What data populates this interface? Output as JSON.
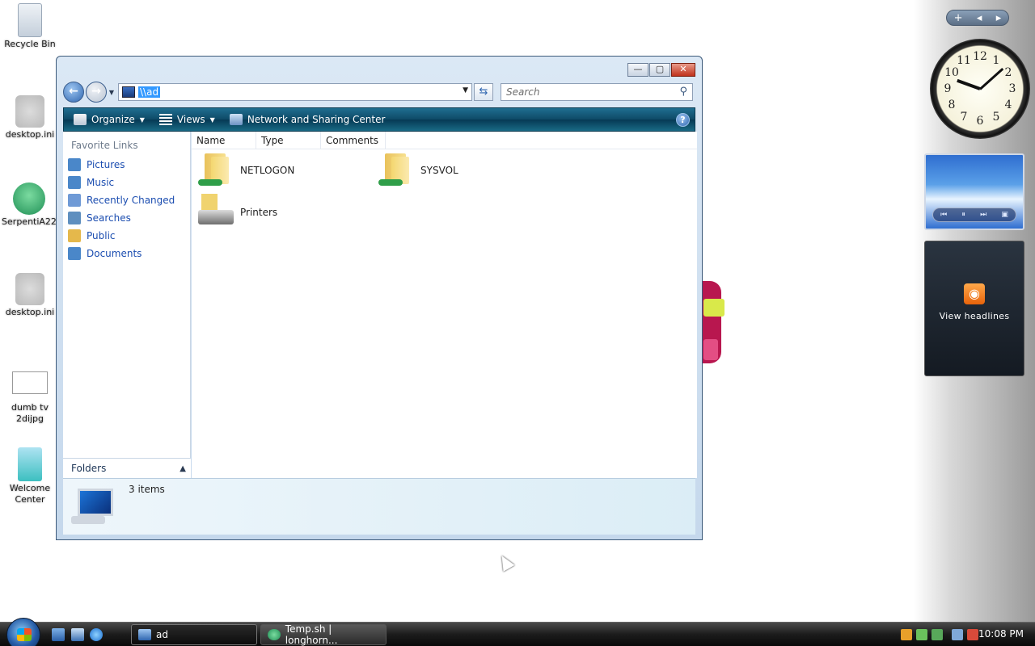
{
  "desktop": {
    "icons": [
      {
        "label": "Recycle Bin"
      },
      {
        "label": "desktop.ini"
      },
      {
        "label": "SerpentiA22"
      },
      {
        "label": "desktop.ini"
      },
      {
        "label": "dumb tv 2dijpg"
      },
      {
        "label": "Welcome Center"
      }
    ]
  },
  "window": {
    "address": "\\\\ad",
    "search_placeholder": "Search",
    "toolbar": {
      "organize": "Organize",
      "views": "Views",
      "network": "Network and Sharing Center",
      "help": "?"
    },
    "favorites_title": "Favorite Links",
    "favorites": [
      {
        "label": "Pictures",
        "color": "#4a87c9"
      },
      {
        "label": "Music",
        "color": "#4a87c9"
      },
      {
        "label": "Recently Changed",
        "color": "#6f9ad6"
      },
      {
        "label": "Searches",
        "color": "#5f8fbf"
      },
      {
        "label": "Public",
        "color": "#e5b84b"
      },
      {
        "label": "Documents",
        "color": "#4a87c9"
      }
    ],
    "folders_label": "Folders",
    "columns": [
      "Name",
      "Type",
      "Comments"
    ],
    "items": [
      {
        "label": "NETLOGON",
        "icon": "shared-folder-icon"
      },
      {
        "label": "SYSVOL",
        "icon": "shared-folder-icon"
      },
      {
        "label": "Printers",
        "icon": "printer-icon"
      }
    ],
    "details": {
      "count": "3 items"
    }
  },
  "gadgets": {
    "feed_label": "View headlines",
    "clock_numbers": [
      "12",
      "1",
      "2",
      "3",
      "4",
      "5",
      "6",
      "7",
      "8",
      "9",
      "10",
      "11"
    ]
  },
  "taskbar": {
    "tasks": [
      "ad",
      "Temp.sh | longhorn..."
    ],
    "time": "10:08 PM"
  }
}
